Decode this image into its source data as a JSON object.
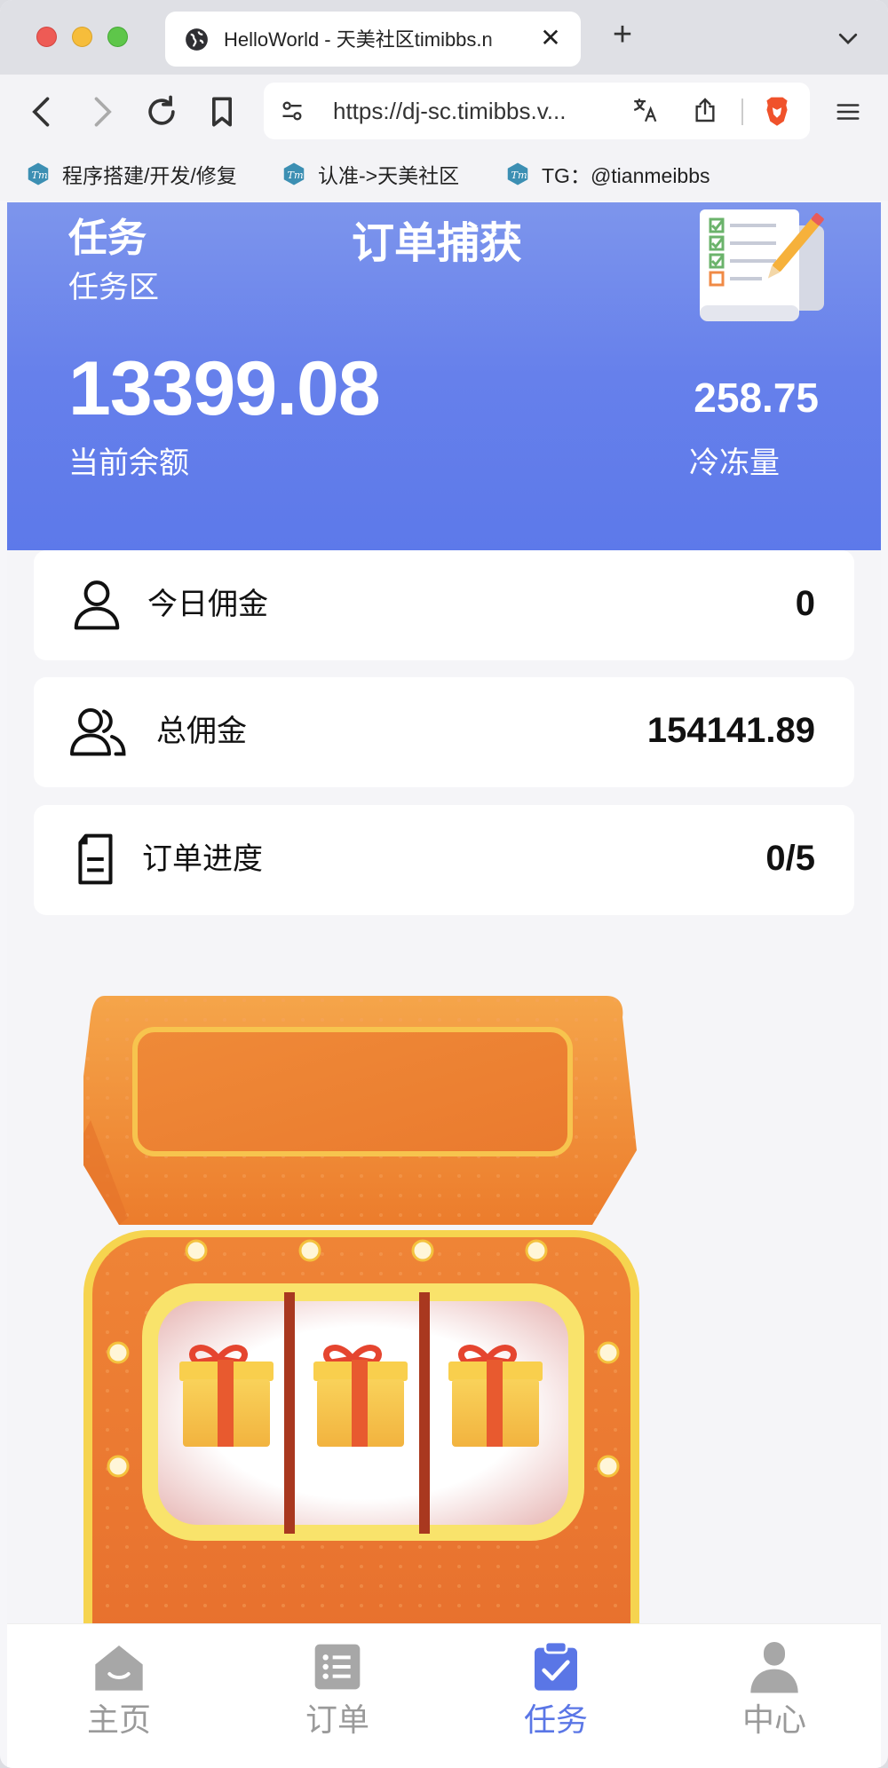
{
  "browser": {
    "tab_title": "HelloWorld - 天美社区timibbs.n",
    "url": "https://dj-sc.timibbs.v...",
    "bookmarks": [
      {
        "label": "程序搭建/开发/修复"
      },
      {
        "label": "认准->天美社区"
      },
      {
        "label": "TG：@tianmeibbs"
      }
    ]
  },
  "header": {
    "title": "任务",
    "subtitle": "任务区",
    "center_title": "订单捕获",
    "balance": "13399.08",
    "balance_label": "当前余额",
    "frozen": "258.75",
    "frozen_label": "冷冻量"
  },
  "stats": [
    {
      "label": "今日佣金",
      "value": "0",
      "icon": "person-icon"
    },
    {
      "label": "总佣金",
      "value": "154141.89",
      "icon": "people-icon"
    },
    {
      "label": "订单进度",
      "value": "0/5",
      "icon": "document-icon"
    }
  ],
  "slot_machine": {
    "reels": [
      "gift-icon",
      "gift-icon",
      "gift-icon"
    ]
  },
  "bottom_nav": [
    {
      "label": "主页",
      "icon": "home-icon",
      "active": false
    },
    {
      "label": "订单",
      "icon": "list-icon",
      "active": false
    },
    {
      "label": "任务",
      "icon": "clipboard-check-icon",
      "active": true
    },
    {
      "label": "中心",
      "icon": "user-icon",
      "active": false
    }
  ],
  "colors": {
    "header_gradient_top": "#7d95ec",
    "header_gradient_bottom": "#5d79ea",
    "accent": "#5a76e6",
    "machine_orange": "#ee7f2f",
    "machine_yellow": "#f9e36b"
  }
}
